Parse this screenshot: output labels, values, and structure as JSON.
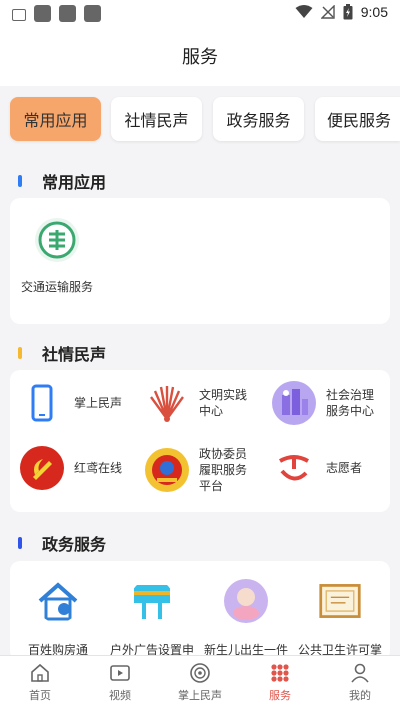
{
  "status_bar": {
    "time": "9:05"
  },
  "page_title": "服务",
  "category_tabs": [
    {
      "label": "常用应用",
      "active": true
    },
    {
      "label": "社情民声",
      "active": false
    },
    {
      "label": "政务服务",
      "active": false
    },
    {
      "label": "便民服务",
      "active": false
    }
  ],
  "sections": {
    "common": {
      "title": "常用应用",
      "accent": "#2f7df6",
      "items": [
        {
          "label": "交通运输服务",
          "icon": "transport-icon"
        }
      ]
    },
    "social": {
      "title": "社情民声",
      "accent": "#f5b82e",
      "items": [
        {
          "label": "掌上民声",
          "icon": "phone-icon"
        },
        {
          "label": "文明实践中心",
          "label_lines": [
            "文明实践",
            "中心"
          ],
          "icon": "civilization-icon"
        },
        {
          "label": "社会治理服务中心",
          "label_lines": [
            "社会治理",
            "服务中心"
          ],
          "icon": "governance-icon"
        },
        {
          "label": "红鸢在线",
          "icon": "party-emblem-icon"
        },
        {
          "label": "政协委员履职服务平台",
          "label_lines": [
            "政协委员",
            "履职服务",
            "平台"
          ],
          "icon": "cppcc-emblem-icon"
        },
        {
          "label": "志愿者",
          "icon": "volunteer-icon"
        }
      ]
    },
    "gov": {
      "title": "政务服务",
      "accent": "#2f54eb",
      "items": [
        {
          "label": "百姓购房通",
          "icon": "house-icon"
        },
        {
          "label": "户外广告设置申",
          "icon": "billboard-icon"
        },
        {
          "label": "新生儿出生一件",
          "icon": "newborn-icon"
        },
        {
          "label": "公共卫生许可掌",
          "icon": "certificate-icon"
        }
      ]
    }
  },
  "bottom_nav": [
    {
      "label": "首页",
      "icon": "home-icon",
      "active": false
    },
    {
      "label": "视频",
      "icon": "video-icon",
      "active": false
    },
    {
      "label": "掌上民声",
      "icon": "voice-icon",
      "active": false
    },
    {
      "label": "服务",
      "icon": "service-grid-icon",
      "active": true
    },
    {
      "label": "我的",
      "icon": "profile-icon",
      "active": false
    }
  ],
  "colors": {
    "active_tab": "#f6a66a",
    "active_nav": "#e0554c",
    "page_bg": "#f4f4f6"
  }
}
